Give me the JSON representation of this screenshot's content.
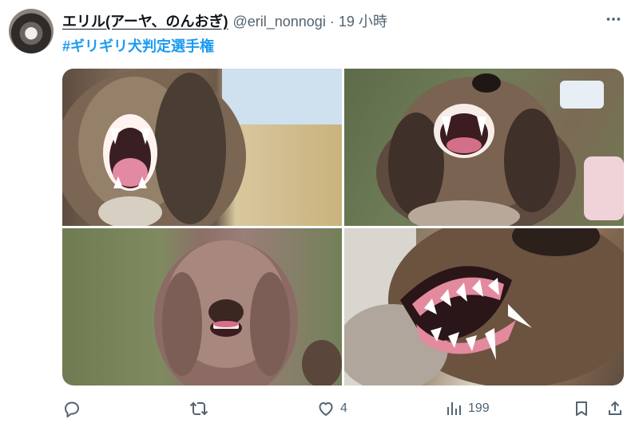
{
  "tweet": {
    "display_name": "エリル(アーヤ、のんおぎ)",
    "handle": "@eril_nonnogi",
    "separator": "·",
    "time": "19 小時",
    "hashtag": "#ギリギリ犬判定選手権"
  },
  "media": [
    {
      "alt": "dog-open-mouth-teeth-1"
    },
    {
      "alt": "dog-bared-teeth-2"
    },
    {
      "alt": "dog-small-teeth-3"
    },
    {
      "alt": "dog-closeup-teeth-4"
    }
  ],
  "actions": {
    "likes": "4",
    "views": "199"
  },
  "colors": {
    "accent": "#1d9bf0",
    "text_secondary": "#536471"
  },
  "icons": [
    "more-icon",
    "reply-icon",
    "retweet-icon",
    "like-icon",
    "views-icon",
    "bookmark-icon",
    "share-icon"
  ]
}
